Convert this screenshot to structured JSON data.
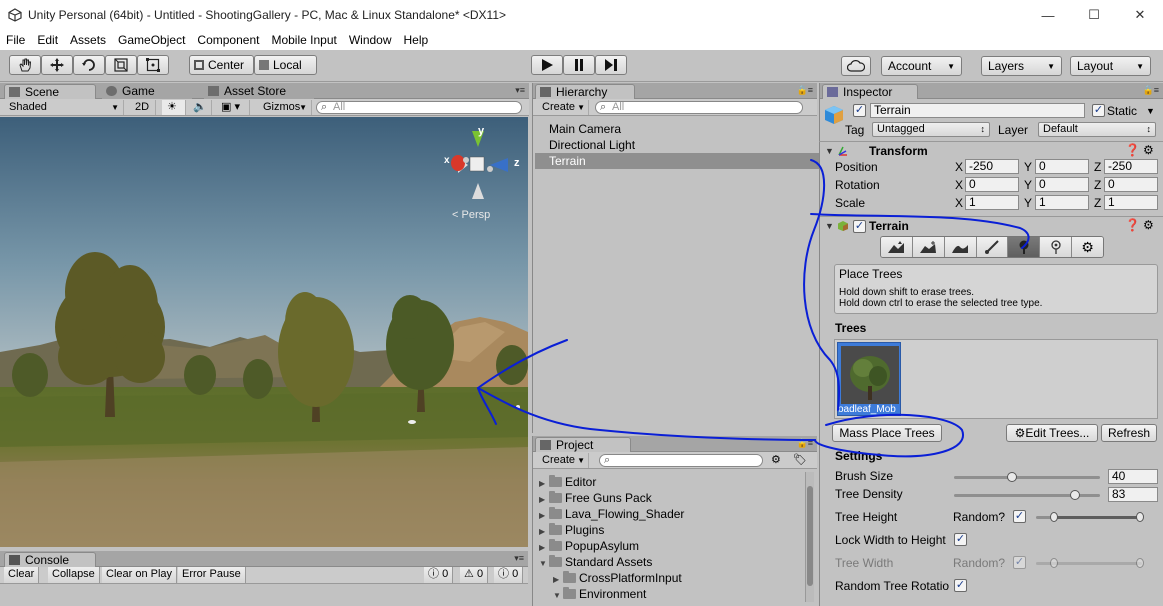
{
  "window": {
    "title": "Unity Personal (64bit) - Untitled - ShootingGallery - PC, Mac & Linux Standalone* <DX11>",
    "minimize": "—",
    "maximize": "☐",
    "close": "✕"
  },
  "menu": [
    "File",
    "Edit",
    "Assets",
    "GameObject",
    "Component",
    "Mobile Input",
    "Window",
    "Help"
  ],
  "toolbar": {
    "pivot_center": "Center",
    "pivot_local": "Local",
    "account": "Account",
    "layers": "Layers",
    "layout": "Layout"
  },
  "scene": {
    "tabs": [
      "Scene",
      "Game",
      "Asset Store"
    ],
    "shading": "Shaded",
    "mode_2d": "2D",
    "gizmos": "Gizmos",
    "search_placeholder": "All",
    "persp": "Persp",
    "axis_x": "x",
    "axis_y": "y",
    "axis_z": "z"
  },
  "hierarchy": {
    "tab": "Hierarchy",
    "create": "Create",
    "search_placeholder": "All",
    "items": [
      "Main Camera",
      "Directional Light",
      "Terrain"
    ]
  },
  "project": {
    "tab": "Project",
    "create": "Create",
    "folders": [
      {
        "label": "Editor"
      },
      {
        "label": "Free Guns Pack"
      },
      {
        "label": "Lava_Flowing_Shader"
      },
      {
        "label": "Plugins"
      },
      {
        "label": "PopupAsylum"
      },
      {
        "label": "Standard Assets"
      },
      {
        "label": "CrossPlatformInput"
      },
      {
        "label": "Environment"
      }
    ]
  },
  "console": {
    "tab": "Console",
    "buttons": [
      "Clear",
      "Collapse",
      "Clear on Play",
      "Error Pause"
    ],
    "counts": [
      "0",
      "0",
      "0"
    ]
  },
  "inspector": {
    "tab": "Inspector",
    "object_name": "Terrain",
    "static_label": "Static",
    "tag_label": "Tag",
    "tag_value": "Untagged",
    "layer_label": "Layer",
    "layer_value": "Default",
    "transform": {
      "header": "Transform",
      "position_label": "Position",
      "rotation_label": "Rotation",
      "scale_label": "Scale",
      "position": [
        "-250",
        "0",
        "-250"
      ],
      "rotation": [
        "0",
        "0",
        "0"
      ],
      "scale": [
        "1",
        "1",
        "1"
      ],
      "axis": [
        "X",
        "Y",
        "Z"
      ]
    },
    "terrain": {
      "header": "Terrain",
      "tool_title": "Place Trees",
      "tool_help_1": "Hold down shift to erase trees.",
      "tool_help_2": "Hold down ctrl to erase the selected tree type.",
      "trees_label": "Trees",
      "tree_prototype": "oadleaf_Mob",
      "mass_place": "Mass Place Trees",
      "edit_trees": "Edit Trees...",
      "refresh": "Refresh",
      "settings_label": "Settings",
      "brush_size_label": "Brush Size",
      "brush_size": "40",
      "tree_density_label": "Tree Density",
      "tree_density": "83",
      "tree_height_label": "Tree Height",
      "random_label": "Random?",
      "lock_width_label": "Lock Width to Height",
      "tree_width_label": "Tree Width",
      "random_rotation_label": "Random Tree Rotatio",
      "brush_size_fraction": 0.4,
      "tree_density_fraction": 0.83
    }
  },
  "colors": {
    "annotation": "#0a1fd6",
    "selection": "#3d7bd9"
  }
}
